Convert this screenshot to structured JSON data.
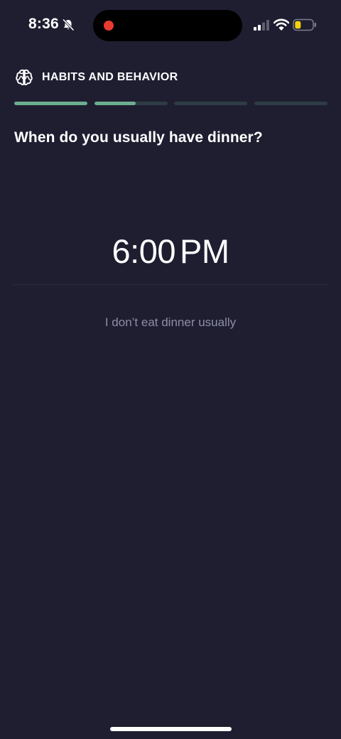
{
  "status_bar": {
    "time": "8:36"
  },
  "header": {
    "section_title": "HABITS AND BEHAVIOR",
    "progress": [
      1.0,
      0.57,
      0.0,
      0.0
    ]
  },
  "question": {
    "text": "When do you usually have dinner?"
  },
  "time_picker": {
    "hour_minute": "6:00",
    "period": "PM"
  },
  "options": {
    "skip_label": "I don’t eat dinner usually"
  },
  "colors": {
    "background": "#1f1e31",
    "progress_fill": "#6cae8f",
    "progress_track": "#2e3c44",
    "recording_dot": "#ea3b32"
  }
}
